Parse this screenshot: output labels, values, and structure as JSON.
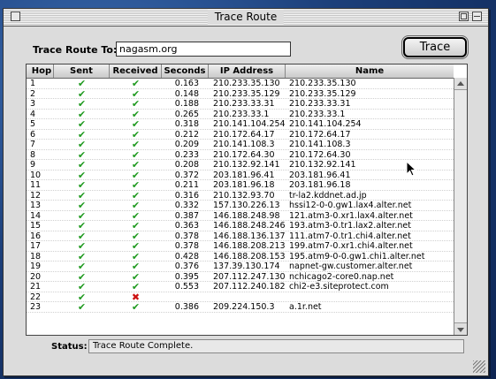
{
  "window": {
    "title": "Trace Route"
  },
  "form": {
    "label": "Trace Route To:",
    "host": "nagasm.org",
    "button": "Trace"
  },
  "table": {
    "headers": [
      "Hop",
      "Sent",
      "Received",
      "Seconds",
      "IP Address",
      "Name"
    ],
    "rows": [
      {
        "hop": "1",
        "sent": "ok",
        "recv": "ok",
        "sec": "0.163",
        "ip": "210.233.35.130",
        "name": "210.233.35.130"
      },
      {
        "hop": "2",
        "sent": "ok",
        "recv": "ok",
        "sec": "0.148",
        "ip": "210.233.35.129",
        "name": "210.233.35.129"
      },
      {
        "hop": "3",
        "sent": "ok",
        "recv": "ok",
        "sec": "0.188",
        "ip": "210.233.33.31",
        "name": "210.233.33.31"
      },
      {
        "hop": "4",
        "sent": "ok",
        "recv": "ok",
        "sec": "0.265",
        "ip": "210.233.33.1",
        "name": "210.233.33.1"
      },
      {
        "hop": "5",
        "sent": "ok",
        "recv": "ok",
        "sec": "0.318",
        "ip": "210.141.104.254",
        "name": "210.141.104.254"
      },
      {
        "hop": "6",
        "sent": "ok",
        "recv": "ok",
        "sec": "0.212",
        "ip": "210.172.64.17",
        "name": "210.172.64.17"
      },
      {
        "hop": "7",
        "sent": "ok",
        "recv": "ok",
        "sec": "0.209",
        "ip": "210.141.108.3",
        "name": "210.141.108.3"
      },
      {
        "hop": "8",
        "sent": "ok",
        "recv": "ok",
        "sec": "0.233",
        "ip": "210.172.64.30",
        "name": "210.172.64.30"
      },
      {
        "hop": "9",
        "sent": "ok",
        "recv": "ok",
        "sec": "0.208",
        "ip": "210.132.92.141",
        "name": "210.132.92.141"
      },
      {
        "hop": "10",
        "sent": "ok",
        "recv": "ok",
        "sec": "0.372",
        "ip": "203.181.96.41",
        "name": "203.181.96.41"
      },
      {
        "hop": "11",
        "sent": "ok",
        "recv": "ok",
        "sec": "0.211",
        "ip": "203.181.96.18",
        "name": "203.181.96.18"
      },
      {
        "hop": "12",
        "sent": "ok",
        "recv": "ok",
        "sec": "0.316",
        "ip": "210.132.93.70",
        "name": "tr-la2.kddnet.ad.jp"
      },
      {
        "hop": "13",
        "sent": "ok",
        "recv": "ok",
        "sec": "0.332",
        "ip": "157.130.226.13",
        "name": "hssi12-0-0.gw1.lax4.alter.net"
      },
      {
        "hop": "14",
        "sent": "ok",
        "recv": "ok",
        "sec": "0.387",
        "ip": "146.188.248.98",
        "name": "121.atm3-0.xr1.lax4.alter.net"
      },
      {
        "hop": "15",
        "sent": "ok",
        "recv": "ok",
        "sec": "0.363",
        "ip": "146.188.248.246",
        "name": "193.atm3-0.tr1.lax2.alter.net"
      },
      {
        "hop": "16",
        "sent": "ok",
        "recv": "ok",
        "sec": "0.378",
        "ip": "146.188.136.137",
        "name": "111.atm7-0.tr1.chi4.alter.net"
      },
      {
        "hop": "17",
        "sent": "ok",
        "recv": "ok",
        "sec": "0.378",
        "ip": "146.188.208.213",
        "name": "199.atm7-0.xr1.chi4.alter.net"
      },
      {
        "hop": "18",
        "sent": "ok",
        "recv": "ok",
        "sec": "0.428",
        "ip": "146.188.208.153",
        "name": "195.atm9-0-0.gw1.chi1.alter.net"
      },
      {
        "hop": "19",
        "sent": "ok",
        "recv": "ok",
        "sec": "0.376",
        "ip": "137.39.130.174",
        "name": "napnet-gw.customer.alter.net"
      },
      {
        "hop": "20",
        "sent": "ok",
        "recv": "ok",
        "sec": "0.395",
        "ip": "207.112.247.130",
        "name": "nchicago2-core0.nap.net"
      },
      {
        "hop": "21",
        "sent": "ok",
        "recv": "ok",
        "sec": "0.553",
        "ip": "207.112.240.182",
        "name": "chi2-e3.siteprotect.com"
      },
      {
        "hop": "22",
        "sent": "ok",
        "recv": "fail",
        "sec": "",
        "ip": "",
        "name": ""
      },
      {
        "hop": "23",
        "sent": "ok",
        "recv": "ok",
        "sec": "0.386",
        "ip": "209.224.150.3",
        "name": "a.1r.net"
      }
    ]
  },
  "status": {
    "label": "Status:",
    "text": "Trace Route Complete."
  },
  "icons": {
    "ok": "checkmark-icon",
    "fail": "x-icon"
  },
  "colors": {
    "ok": "#1f9a1f",
    "fail": "#cc1010"
  }
}
